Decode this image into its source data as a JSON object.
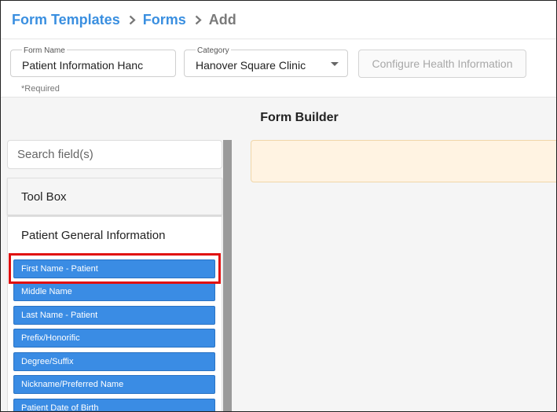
{
  "breadcrumb": {
    "items": [
      "Form Templates",
      "Forms"
    ],
    "current": "Add"
  },
  "form_name": {
    "label": "Form Name",
    "value": "Patient Information Hanc"
  },
  "category": {
    "label": "Category",
    "value": "Hanover Square Clinic"
  },
  "configure_button": "Configure Health Information",
  "required_note": "*Required",
  "form_builder_title": "Form Builder",
  "search": {
    "placeholder": "Search field(s)"
  },
  "toolbox_label": "Tool Box",
  "section": {
    "title": "Patient General Information",
    "fields": [
      "First Name - Patient",
      "Middle Name",
      "Last Name - Patient",
      "Prefix/Honorific",
      "Degree/Suffix",
      "Nickname/Preferred Name",
      "Patient Date of Birth"
    ]
  },
  "colors": {
    "link": "#3a8fe0",
    "chip": "#3a8ce4",
    "highlight": "#e01010",
    "drop_zone": "#fff3e2"
  }
}
